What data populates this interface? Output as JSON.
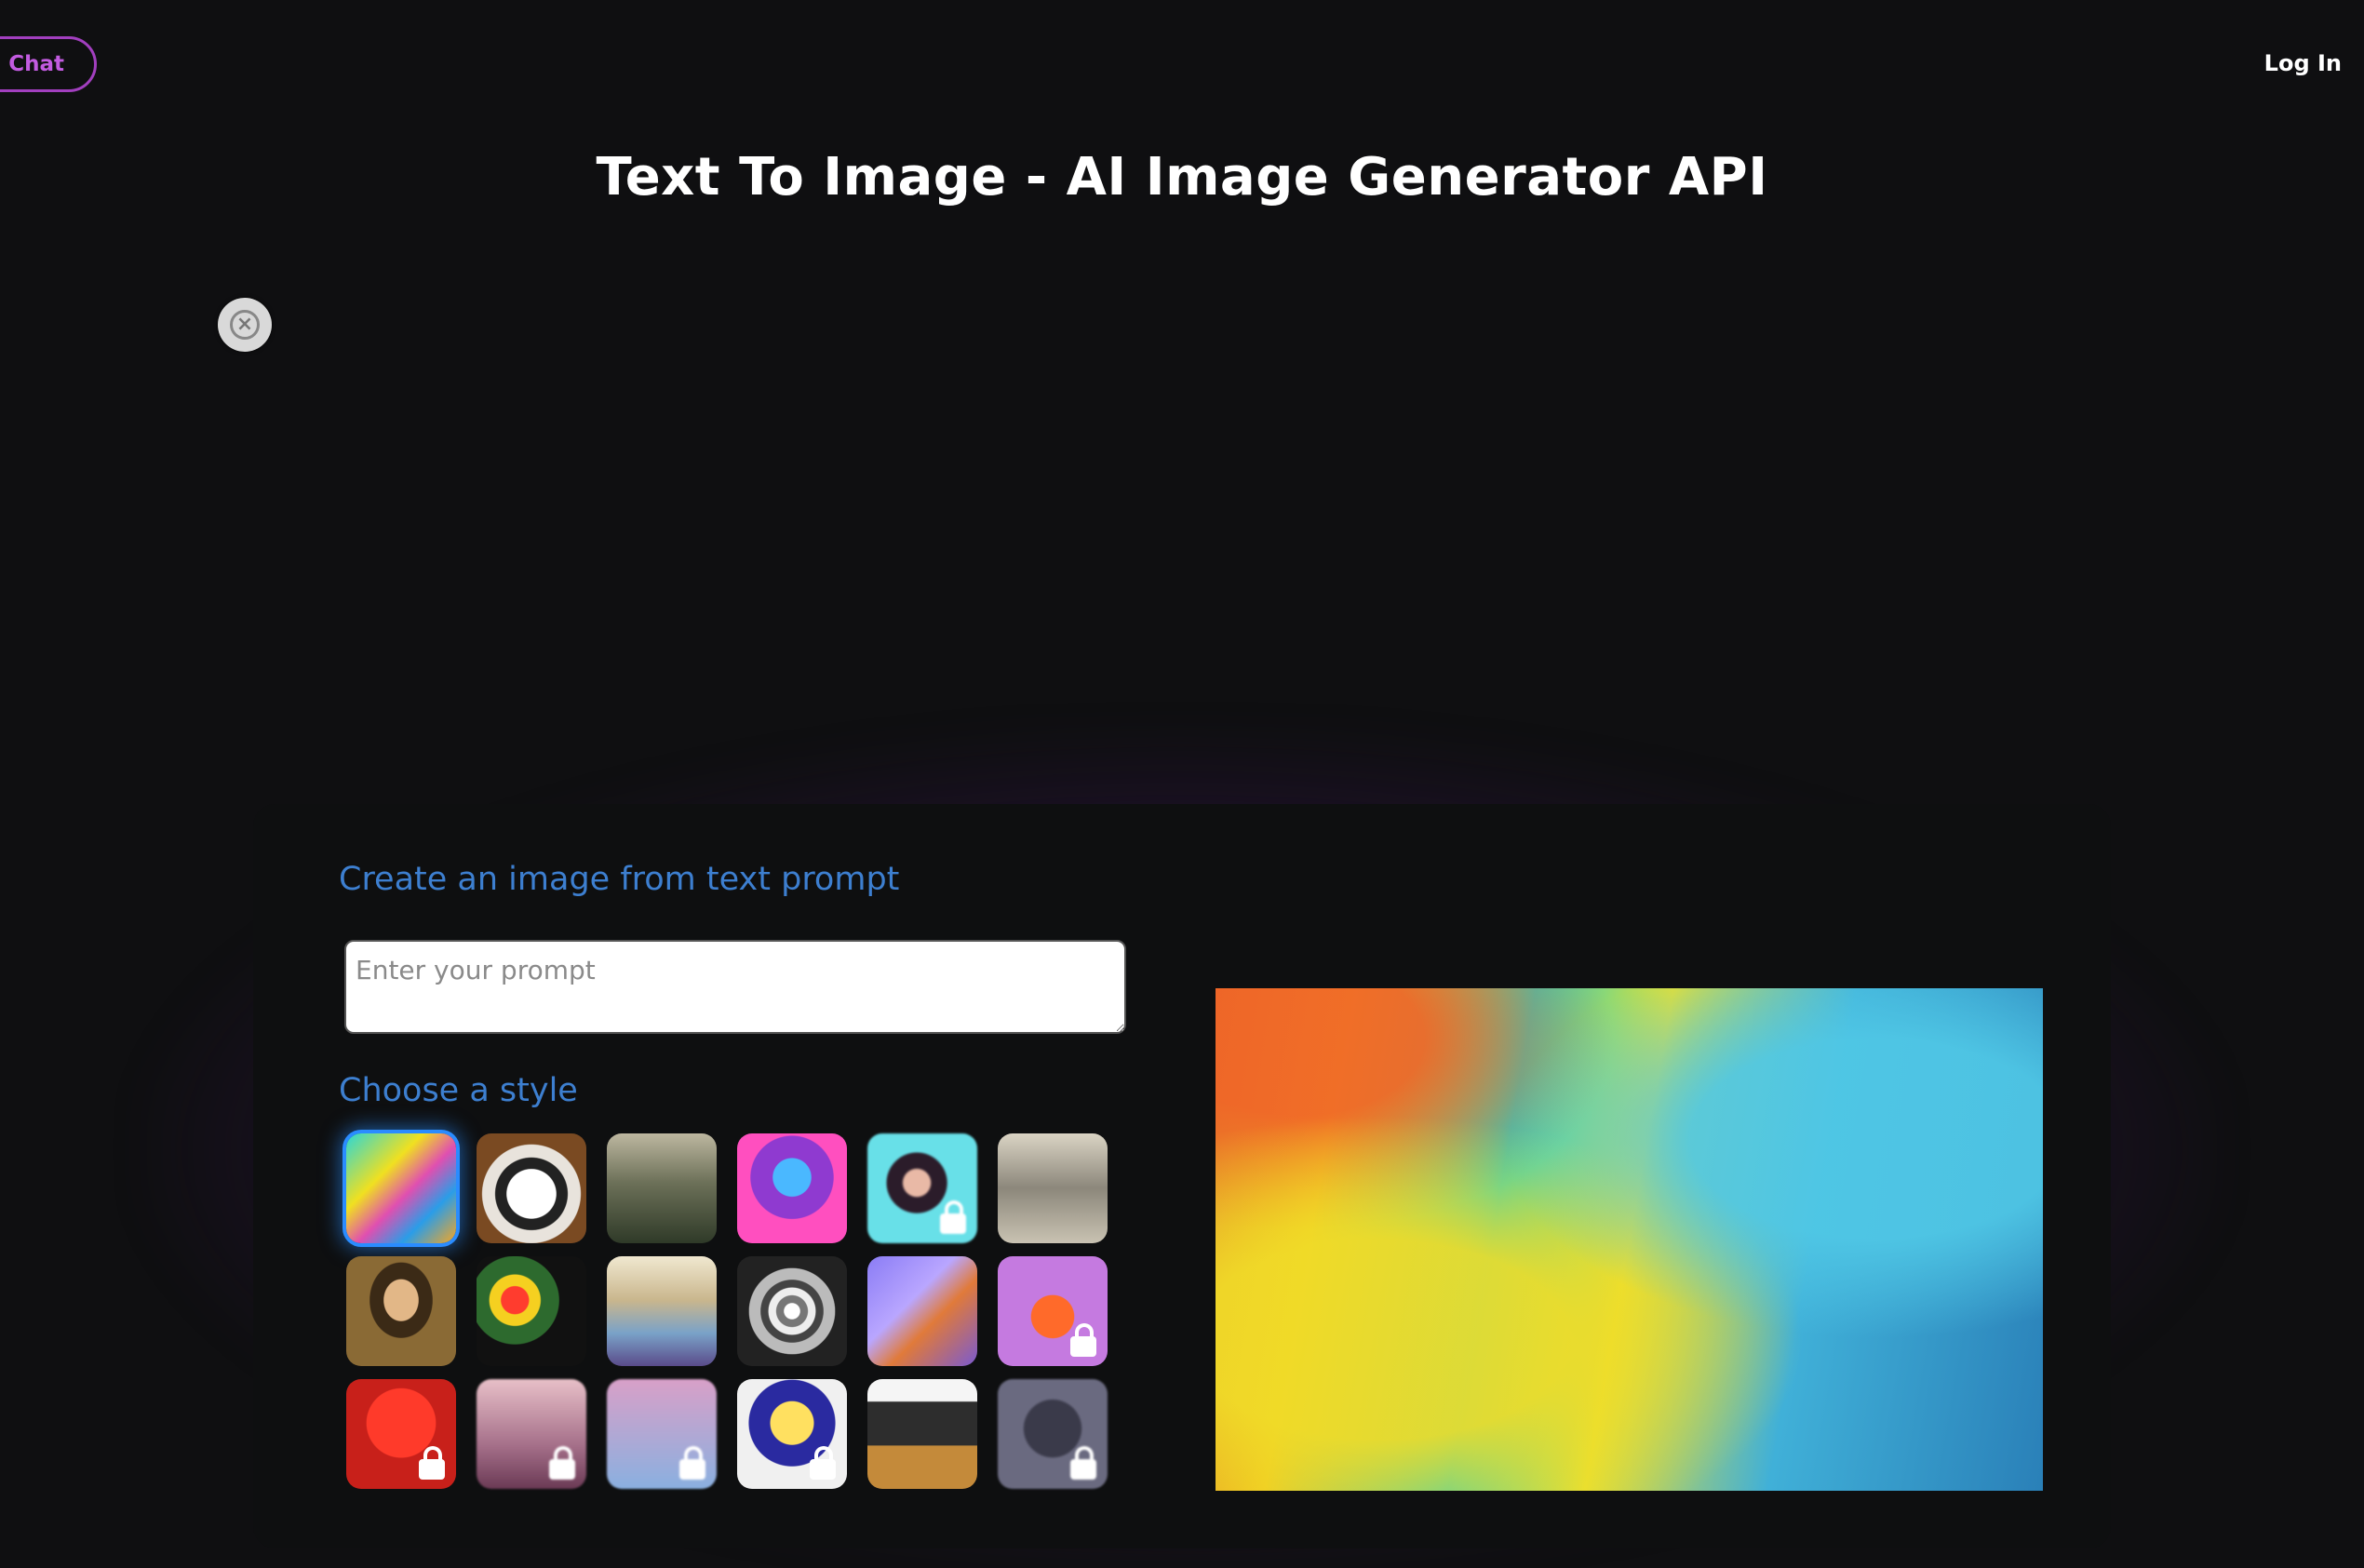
{
  "header": {
    "chat_button": "I Chat",
    "login": "Log In",
    "title": "Text To Image - AI Image Generator API"
  },
  "ad": {
    "close_icon": "close-icon"
  },
  "panel": {
    "create_heading": "Create an image from text prompt",
    "prompt_placeholder": "Enter your prompt",
    "style_heading": "Choose a style",
    "styles": [
      {
        "name": "colorful-abstract",
        "locked": false,
        "selected": true
      },
      {
        "name": "panda",
        "locked": false
      },
      {
        "name": "landscape-painting",
        "locked": false
      },
      {
        "name": "robot-neon",
        "locked": false
      },
      {
        "name": "portrait-teal",
        "locked": true
      },
      {
        "name": "vintage-engraving",
        "locked": false
      },
      {
        "name": "renaissance-portrait",
        "locked": false
      },
      {
        "name": "flowers-vase",
        "locked": false
      },
      {
        "name": "ballet-dancers",
        "locked": false
      },
      {
        "name": "spiral-bw",
        "locked": false
      },
      {
        "name": "isometric-frame",
        "locked": false
      },
      {
        "name": "cartoon-fox",
        "locked": true
      },
      {
        "name": "red-figure",
        "locked": true
      },
      {
        "name": "soft-portrait",
        "locked": true
      },
      {
        "name": "pastel-blur",
        "locked": true
      },
      {
        "name": "pop-art",
        "locked": true
      },
      {
        "name": "modern-house",
        "locked": false
      },
      {
        "name": "dark-creature",
        "locked": true
      }
    ]
  },
  "colors": {
    "background": "#0f0f11",
    "accent_purple": "#a23fbf",
    "heading_blue": "#3d7fd0",
    "selected_blue": "#2a8cff"
  }
}
